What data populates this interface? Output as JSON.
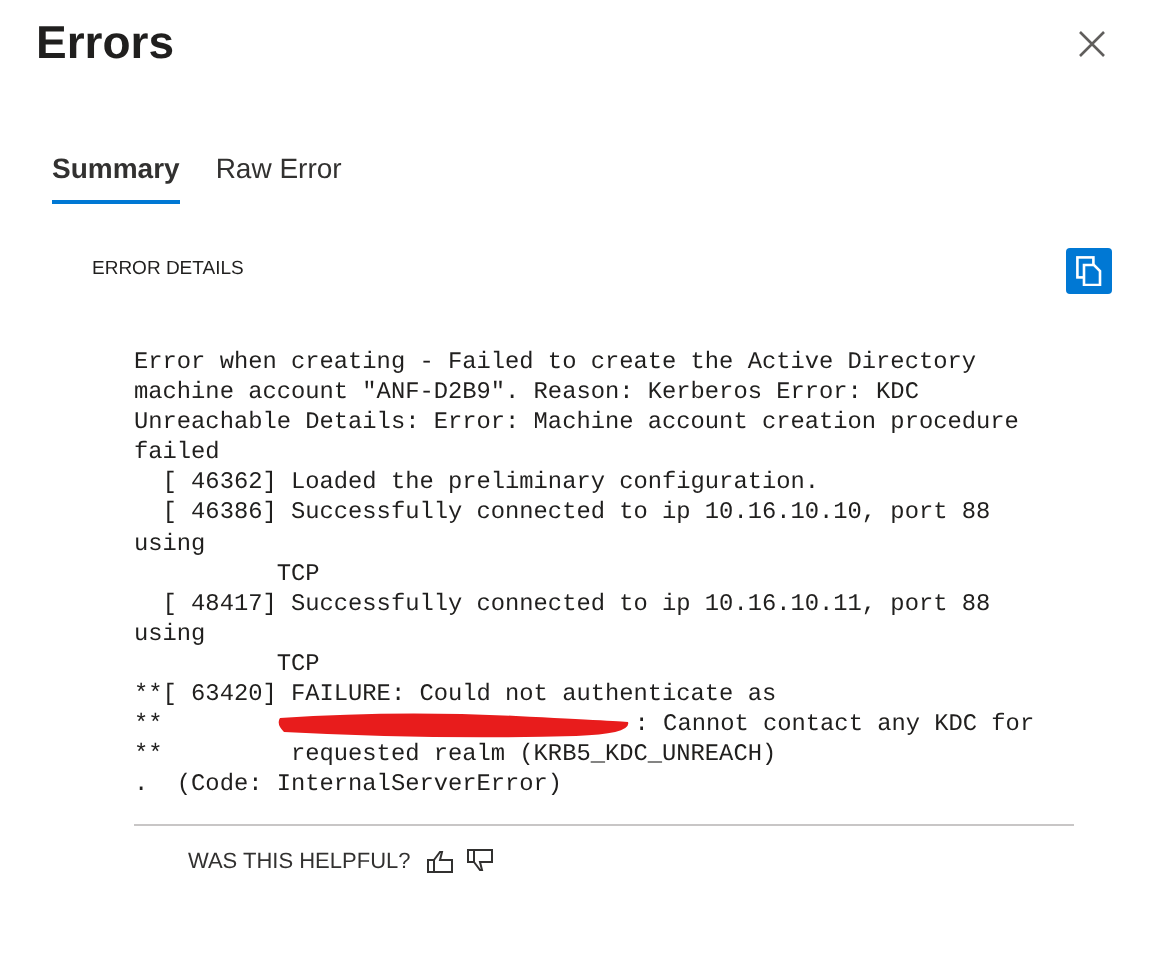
{
  "title": "Errors",
  "tabs": [
    {
      "label": "Summary",
      "selected": true
    },
    {
      "label": "Raw Error",
      "selected": false
    }
  ],
  "section_label": "ERROR DETAILS",
  "error_lines": [
    {
      "kind": "text",
      "text": "Error when creating - Failed to create the Active Directory"
    },
    {
      "kind": "text",
      "text": "machine account \"ANF-D2B9\". Reason: Kerberos Error: KDC"
    },
    {
      "kind": "text",
      "text": "Unreachable Details: Error: Machine account creation procedure"
    },
    {
      "kind": "text",
      "text": "failed"
    },
    {
      "kind": "text",
      "text": "  [ 46362] Loaded the preliminary configuration."
    },
    {
      "kind": "text",
      "text": "  [ 46386] Successfully connected to ip 10.16.10.10, port 88"
    },
    {
      "kind": "text",
      "text": "using"
    },
    {
      "kind": "text",
      "text": "          TCP"
    },
    {
      "kind": "text",
      "text": "  [ 48417] Successfully connected to ip 10.16.10.11, port 88"
    },
    {
      "kind": "text",
      "text": "using"
    },
    {
      "kind": "text",
      "text": "          TCP"
    },
    {
      "kind": "text",
      "text": "**[ 63420] FAILURE: Could not authenticate as"
    },
    {
      "kind": "redacted",
      "before": "**",
      "after": ": Cannot contact any KDC for"
    },
    {
      "kind": "text",
      "text": "**         requested realm (KRB5_KDC_UNREACH)"
    },
    {
      "kind": "text",
      "text": ".  (Code: InternalServerError)"
    }
  ],
  "feedback": {
    "question": "WAS THIS HELPFUL?"
  }
}
